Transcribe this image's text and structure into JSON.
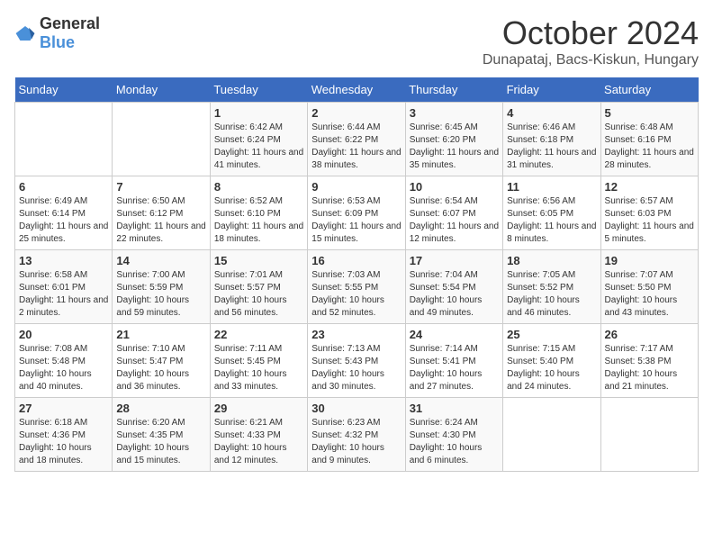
{
  "header": {
    "logo_general": "General",
    "logo_blue": "Blue",
    "month": "October 2024",
    "location": "Dunapataj, Bacs-Kiskun, Hungary"
  },
  "days_of_week": [
    "Sunday",
    "Monday",
    "Tuesday",
    "Wednesday",
    "Thursday",
    "Friday",
    "Saturday"
  ],
  "weeks": [
    [
      {
        "day": "",
        "info": ""
      },
      {
        "day": "",
        "info": ""
      },
      {
        "day": "1",
        "info": "Sunrise: 6:42 AM\nSunset: 6:24 PM\nDaylight: 11 hours and 41 minutes."
      },
      {
        "day": "2",
        "info": "Sunrise: 6:44 AM\nSunset: 6:22 PM\nDaylight: 11 hours and 38 minutes."
      },
      {
        "day": "3",
        "info": "Sunrise: 6:45 AM\nSunset: 6:20 PM\nDaylight: 11 hours and 35 minutes."
      },
      {
        "day": "4",
        "info": "Sunrise: 6:46 AM\nSunset: 6:18 PM\nDaylight: 11 hours and 31 minutes."
      },
      {
        "day": "5",
        "info": "Sunrise: 6:48 AM\nSunset: 6:16 PM\nDaylight: 11 hours and 28 minutes."
      }
    ],
    [
      {
        "day": "6",
        "info": "Sunrise: 6:49 AM\nSunset: 6:14 PM\nDaylight: 11 hours and 25 minutes."
      },
      {
        "day": "7",
        "info": "Sunrise: 6:50 AM\nSunset: 6:12 PM\nDaylight: 11 hours and 22 minutes."
      },
      {
        "day": "8",
        "info": "Sunrise: 6:52 AM\nSunset: 6:10 PM\nDaylight: 11 hours and 18 minutes."
      },
      {
        "day": "9",
        "info": "Sunrise: 6:53 AM\nSunset: 6:09 PM\nDaylight: 11 hours and 15 minutes."
      },
      {
        "day": "10",
        "info": "Sunrise: 6:54 AM\nSunset: 6:07 PM\nDaylight: 11 hours and 12 minutes."
      },
      {
        "day": "11",
        "info": "Sunrise: 6:56 AM\nSunset: 6:05 PM\nDaylight: 11 hours and 8 minutes."
      },
      {
        "day": "12",
        "info": "Sunrise: 6:57 AM\nSunset: 6:03 PM\nDaylight: 11 hours and 5 minutes."
      }
    ],
    [
      {
        "day": "13",
        "info": "Sunrise: 6:58 AM\nSunset: 6:01 PM\nDaylight: 11 hours and 2 minutes."
      },
      {
        "day": "14",
        "info": "Sunrise: 7:00 AM\nSunset: 5:59 PM\nDaylight: 10 hours and 59 minutes."
      },
      {
        "day": "15",
        "info": "Sunrise: 7:01 AM\nSunset: 5:57 PM\nDaylight: 10 hours and 56 minutes."
      },
      {
        "day": "16",
        "info": "Sunrise: 7:03 AM\nSunset: 5:55 PM\nDaylight: 10 hours and 52 minutes."
      },
      {
        "day": "17",
        "info": "Sunrise: 7:04 AM\nSunset: 5:54 PM\nDaylight: 10 hours and 49 minutes."
      },
      {
        "day": "18",
        "info": "Sunrise: 7:05 AM\nSunset: 5:52 PM\nDaylight: 10 hours and 46 minutes."
      },
      {
        "day": "19",
        "info": "Sunrise: 7:07 AM\nSunset: 5:50 PM\nDaylight: 10 hours and 43 minutes."
      }
    ],
    [
      {
        "day": "20",
        "info": "Sunrise: 7:08 AM\nSunset: 5:48 PM\nDaylight: 10 hours and 40 minutes."
      },
      {
        "day": "21",
        "info": "Sunrise: 7:10 AM\nSunset: 5:47 PM\nDaylight: 10 hours and 36 minutes."
      },
      {
        "day": "22",
        "info": "Sunrise: 7:11 AM\nSunset: 5:45 PM\nDaylight: 10 hours and 33 minutes."
      },
      {
        "day": "23",
        "info": "Sunrise: 7:13 AM\nSunset: 5:43 PM\nDaylight: 10 hours and 30 minutes."
      },
      {
        "day": "24",
        "info": "Sunrise: 7:14 AM\nSunset: 5:41 PM\nDaylight: 10 hours and 27 minutes."
      },
      {
        "day": "25",
        "info": "Sunrise: 7:15 AM\nSunset: 5:40 PM\nDaylight: 10 hours and 24 minutes."
      },
      {
        "day": "26",
        "info": "Sunrise: 7:17 AM\nSunset: 5:38 PM\nDaylight: 10 hours and 21 minutes."
      }
    ],
    [
      {
        "day": "27",
        "info": "Sunrise: 6:18 AM\nSunset: 4:36 PM\nDaylight: 10 hours and 18 minutes."
      },
      {
        "day": "28",
        "info": "Sunrise: 6:20 AM\nSunset: 4:35 PM\nDaylight: 10 hours and 15 minutes."
      },
      {
        "day": "29",
        "info": "Sunrise: 6:21 AM\nSunset: 4:33 PM\nDaylight: 10 hours and 12 minutes."
      },
      {
        "day": "30",
        "info": "Sunrise: 6:23 AM\nSunset: 4:32 PM\nDaylight: 10 hours and 9 minutes."
      },
      {
        "day": "31",
        "info": "Sunrise: 6:24 AM\nSunset: 4:30 PM\nDaylight: 10 hours and 6 minutes."
      },
      {
        "day": "",
        "info": ""
      },
      {
        "day": "",
        "info": ""
      }
    ]
  ]
}
